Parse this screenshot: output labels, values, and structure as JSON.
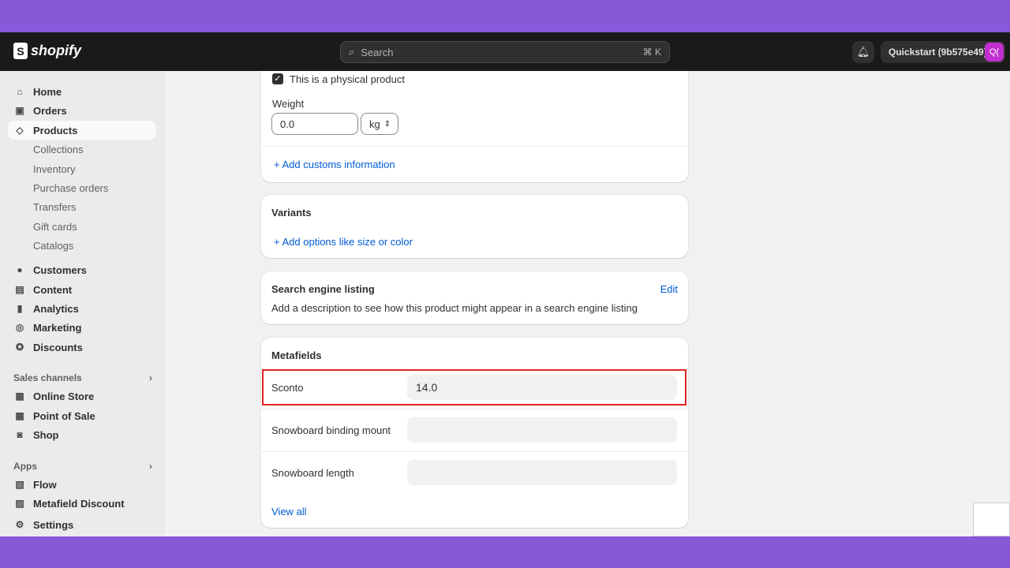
{
  "brand": "shopify",
  "search": {
    "placeholder": "Search",
    "shortcut": "⌘ K"
  },
  "store": {
    "name": "Quickstart (9b575e49)",
    "avatar": "Q("
  },
  "sidebar": {
    "items": [
      {
        "label": "Home",
        "icon": "home"
      },
      {
        "label": "Orders",
        "icon": "inbox"
      },
      {
        "label": "Products",
        "icon": "tag",
        "active": true
      },
      {
        "label": "Collections"
      },
      {
        "label": "Inventory"
      },
      {
        "label": "Purchase orders"
      },
      {
        "label": "Transfers"
      },
      {
        "label": "Gift cards"
      },
      {
        "label": "Catalogs"
      },
      {
        "label": "Customers",
        "icon": "person"
      },
      {
        "label": "Content",
        "icon": "content"
      },
      {
        "label": "Analytics",
        "icon": "bar-chart"
      },
      {
        "label": "Marketing",
        "icon": "target"
      },
      {
        "label": "Discounts",
        "icon": "discount"
      }
    ],
    "sales_channels": {
      "title": "Sales channels",
      "items": [
        "Online Store",
        "Point of Sale",
        "Shop"
      ]
    },
    "apps": {
      "title": "Apps",
      "items": [
        "Flow",
        "Metafield Discount"
      ]
    },
    "settings": "Settings"
  },
  "shipping": {
    "physical_label": "This is a physical product",
    "physical_checked": true,
    "weight_label": "Weight",
    "weight_value": "0.0",
    "unit": "kg",
    "customs": "Add customs information"
  },
  "variants": {
    "title": "Variants",
    "add": "Add options like size or color"
  },
  "seo": {
    "title": "Search engine listing",
    "edit": "Edit",
    "description": "Add a description to see how this product might appear in a search engine listing"
  },
  "metafields": {
    "title": "Metafields",
    "rows": [
      {
        "label": "Sconto",
        "value": "14.0"
      },
      {
        "label": "Snowboard binding mount",
        "value": ""
      },
      {
        "label": "Snowboard length",
        "value": ""
      }
    ],
    "view_all": "View all"
  },
  "colors": {
    "highlight": "#e02424",
    "link": "#005bd3",
    "frame": "#8659d9"
  }
}
